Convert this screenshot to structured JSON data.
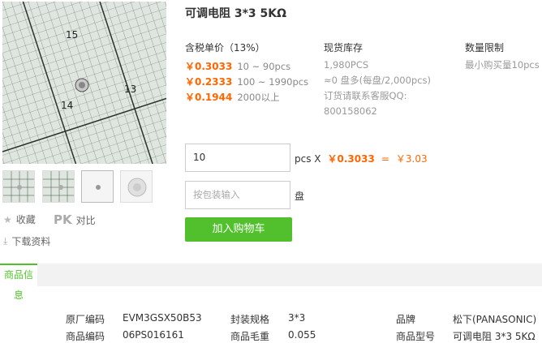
{
  "product": {
    "title": "可调电阻 3*3 5KΩ"
  },
  "pricing": {
    "header": "含税单价（13%）",
    "tiers": [
      {
        "price": "￥0.3033",
        "range": "10 ~ 90pcs"
      },
      {
        "price": "￥0.2333",
        "range": "100 ~ 1990pcs"
      },
      {
        "price": "￥0.1944",
        "range": "2000以上"
      }
    ]
  },
  "stock": {
    "header": "现货库存",
    "count": "1,980PCS",
    "reel": "≈0 盘多(每盘/2,000pcs)",
    "contact_line1": "订货请联系客服QQ:",
    "contact_line2": "800158062"
  },
  "limit": {
    "header": "数量限制",
    "min": "最小购买量10pcs"
  },
  "order": {
    "qty_value": "10",
    "unit": "pcs X",
    "unit_price": "￥0.3033",
    "equals": "=",
    "total": "￥3.03",
    "pack_placeholder": "按包装输入",
    "pack_unit": "盘",
    "cart_label": "加入购物车"
  },
  "tools": {
    "favorite": "收藏",
    "pk": "PK",
    "compare": "对比",
    "download": "下载资料"
  },
  "tabs": {
    "info": "商品信息"
  },
  "specs": [
    {
      "label": "原厂编码",
      "value": "EVM3GSX50B53"
    },
    {
      "label": "封装规格",
      "value": "3*3"
    },
    {
      "label": "品牌",
      "value": "松下(PANASONIC)"
    },
    {
      "label": "商品编码",
      "value": "06PS016161"
    },
    {
      "label": "商品毛重",
      "value": "0.055"
    },
    {
      "label": "商品型号",
      "value": "可调电阻 3*3 5KΩ"
    }
  ],
  "image_scale_labels": [
    "13",
    "14",
    "15"
  ],
  "colors": {
    "accent_green": "#52c02d",
    "price_orange": "#ff6600"
  }
}
